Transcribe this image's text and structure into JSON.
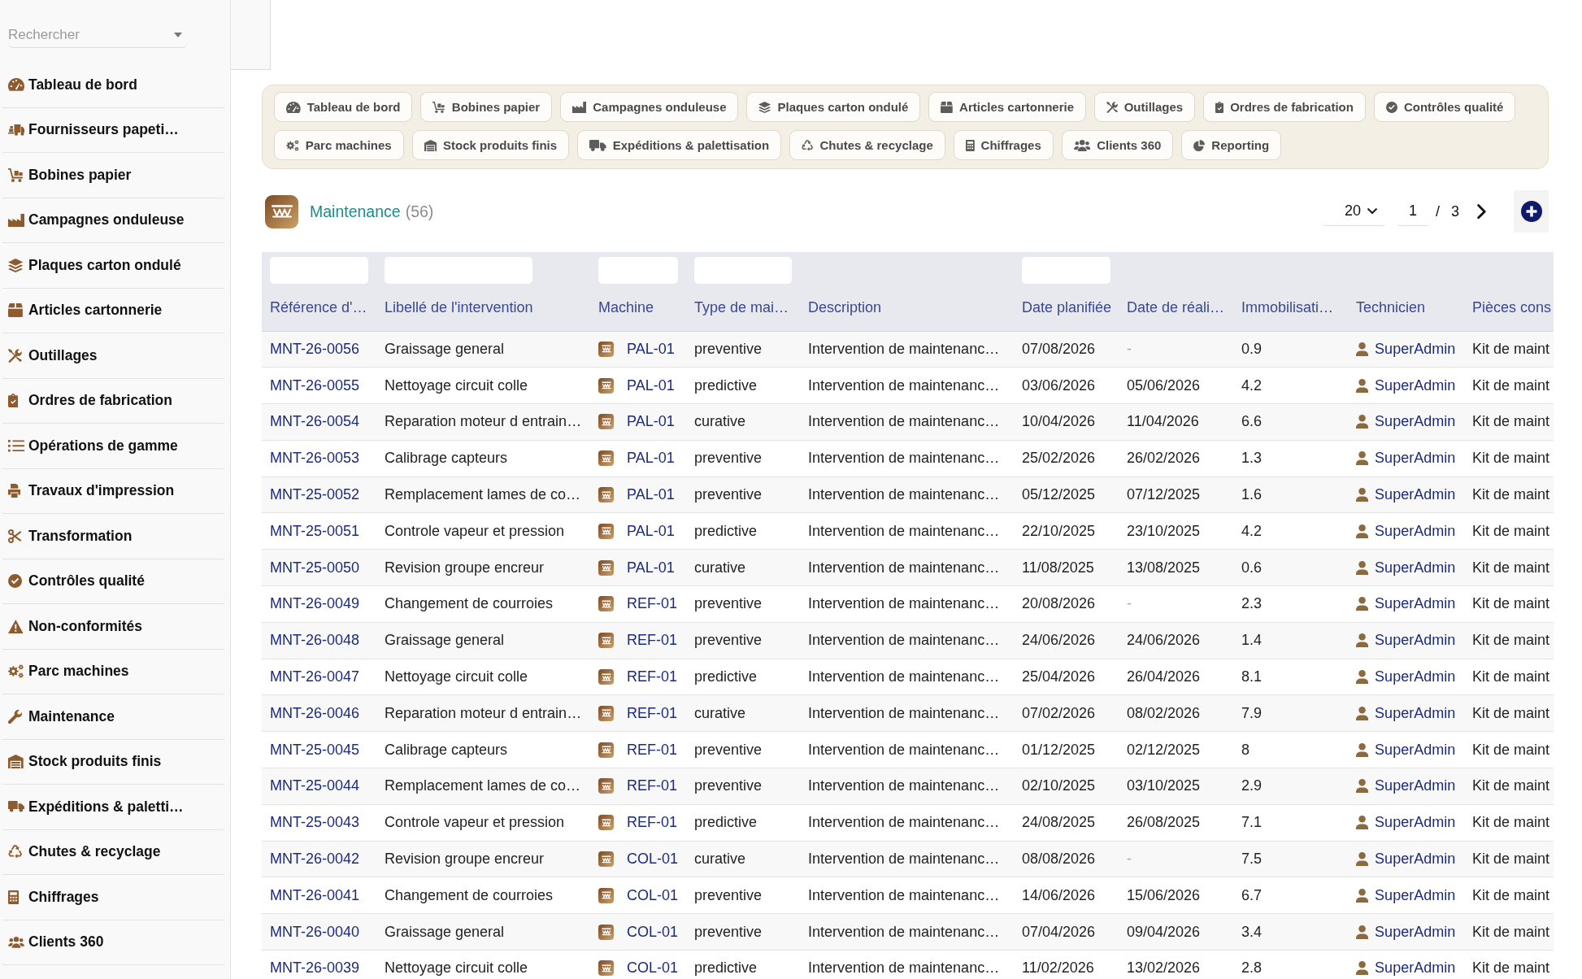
{
  "sidebar": {
    "search": {
      "placeholder": "Rechercher"
    },
    "items": [
      {
        "label": "Tableau de bord"
      },
      {
        "label": "Fournisseurs papeti…"
      },
      {
        "label": "Bobines papier"
      },
      {
        "label": "Campagnes onduleuse"
      },
      {
        "label": "Plaques carton ondulé"
      },
      {
        "label": "Articles cartonnerie"
      },
      {
        "label": "Outillages"
      },
      {
        "label": "Ordres de fabrication"
      },
      {
        "label": "Opérations de gamme"
      },
      {
        "label": "Travaux d'impression"
      },
      {
        "label": "Transformation"
      },
      {
        "label": "Contrôles qualité"
      },
      {
        "label": "Non-conformités"
      },
      {
        "label": "Parc machines"
      },
      {
        "label": "Maintenance"
      },
      {
        "label": "Stock produits finis"
      },
      {
        "label": "Expéditions & paletti…"
      },
      {
        "label": "Chutes & recyclage"
      },
      {
        "label": "Chiffrages"
      },
      {
        "label": "Clients 360"
      }
    ]
  },
  "tab_rows": [
    {
      "tabs": [
        {
          "label": "Tableau de bord"
        },
        {
          "label": "Bobines papier"
        },
        {
          "label": "Campagnes onduleuse"
        },
        {
          "label": "Plaques carton ondulé"
        },
        {
          "label": "Articles cartonnerie"
        },
        {
          "label": "Outillages"
        },
        {
          "label": "Ordres de fabrication"
        },
        {
          "label": "Contrôles qualité"
        }
      ]
    },
    {
      "tabs": [
        {
          "label": "Parc machines"
        },
        {
          "label": "Stock produits finis"
        },
        {
          "label": "Expéditions & palettisation"
        },
        {
          "label": "Chutes & recyclage"
        },
        {
          "label": "Chiffrages"
        },
        {
          "label": "Clients 360"
        },
        {
          "label": "Reporting"
        }
      ]
    }
  ],
  "header": {
    "title": "Maintenance",
    "count": "(56)"
  },
  "pagination": {
    "page_size": "20",
    "page": "1",
    "separator": "/",
    "total_pages": "3"
  },
  "table": {
    "columns": [
      {
        "label": "Référence d'…",
        "filter": true
      },
      {
        "label": "Libellé de l'intervention",
        "filter": true
      },
      {
        "label": "Machine",
        "filter": true
      },
      {
        "label": "Type de mai…",
        "filter": true
      },
      {
        "label": "Description",
        "filter": false
      },
      {
        "label": "Date planifiée",
        "filter": true
      },
      {
        "label": "Date de réali…",
        "filter": false
      },
      {
        "label": "Immobilisati…",
        "filter": false
      },
      {
        "label": "Technicien",
        "filter": false
      },
      {
        "label": "Pièces cons",
        "filter": false
      }
    ],
    "rows": [
      {
        "reference": "MNT-26-0056",
        "title": "Graissage general",
        "machine": "PAL-01",
        "type": "preventive",
        "description": "Intervention de maintenanc…",
        "planned": "07/08/2026",
        "completed": "-",
        "done": false,
        "downtime": "0.9",
        "technician": "SuperAdmin",
        "parts": "Kit de maint"
      },
      {
        "reference": "MNT-26-0055",
        "title": "Nettoyage circuit colle",
        "machine": "PAL-01",
        "type": "predictive",
        "description": "Intervention de maintenanc…",
        "planned": "03/06/2026",
        "completed": "05/06/2026",
        "done": true,
        "downtime": "4.2",
        "technician": "SuperAdmin",
        "parts": "Kit de maint"
      },
      {
        "reference": "MNT-26-0054",
        "title": "Reparation moteur d entrain…",
        "machine": "PAL-01",
        "type": "curative",
        "description": "Intervention de maintenanc…",
        "planned": "10/04/2026",
        "completed": "11/04/2026",
        "done": true,
        "downtime": "6.6",
        "technician": "SuperAdmin",
        "parts": "Kit de maint"
      },
      {
        "reference": "MNT-26-0053",
        "title": "Calibrage capteurs",
        "machine": "PAL-01",
        "type": "preventive",
        "description": "Intervention de maintenanc…",
        "planned": "25/02/2026",
        "completed": "26/02/2026",
        "done": true,
        "downtime": "1.3",
        "technician": "SuperAdmin",
        "parts": "Kit de maint"
      },
      {
        "reference": "MNT-25-0052",
        "title": "Remplacement lames de co…",
        "machine": "PAL-01",
        "type": "preventive",
        "description": "Intervention de maintenanc…",
        "planned": "05/12/2025",
        "completed": "07/12/2025",
        "done": true,
        "downtime": "1.6",
        "technician": "SuperAdmin",
        "parts": "Kit de maint"
      },
      {
        "reference": "MNT-25-0051",
        "title": "Controle vapeur et pression",
        "machine": "PAL-01",
        "type": "predictive",
        "description": "Intervention de maintenanc…",
        "planned": "22/10/2025",
        "completed": "23/10/2025",
        "done": true,
        "downtime": "4.2",
        "technician": "SuperAdmin",
        "parts": "Kit de maint"
      },
      {
        "reference": "MNT-25-0050",
        "title": "Revision groupe encreur",
        "machine": "PAL-01",
        "type": "curative",
        "description": "Intervention de maintenanc…",
        "planned": "11/08/2025",
        "completed": "13/08/2025",
        "done": true,
        "downtime": "0.6",
        "technician": "SuperAdmin",
        "parts": "Kit de maint"
      },
      {
        "reference": "MNT-26-0049",
        "title": "Changement de courroies",
        "machine": "REF-01",
        "type": "preventive",
        "description": "Intervention de maintenanc…",
        "planned": "20/08/2026",
        "completed": "-",
        "done": false,
        "downtime": "2.3",
        "technician": "SuperAdmin",
        "parts": "Kit de maint"
      },
      {
        "reference": "MNT-26-0048",
        "title": "Graissage general",
        "machine": "REF-01",
        "type": "preventive",
        "description": "Intervention de maintenanc…",
        "planned": "24/06/2026",
        "completed": "24/06/2026",
        "done": true,
        "downtime": "1.4",
        "technician": "SuperAdmin",
        "parts": "Kit de maint"
      },
      {
        "reference": "MNT-26-0047",
        "title": "Nettoyage circuit colle",
        "machine": "REF-01",
        "type": "predictive",
        "description": "Intervention de maintenanc…",
        "planned": "25/04/2026",
        "completed": "26/04/2026",
        "done": true,
        "downtime": "8.1",
        "technician": "SuperAdmin",
        "parts": "Kit de maint"
      },
      {
        "reference": "MNT-26-0046",
        "title": "Reparation moteur d entrain…",
        "machine": "REF-01",
        "type": "curative",
        "description": "Intervention de maintenanc…",
        "planned": "07/02/2026",
        "completed": "08/02/2026",
        "done": true,
        "downtime": "7.9",
        "technician": "SuperAdmin",
        "parts": "Kit de maint"
      },
      {
        "reference": "MNT-25-0045",
        "title": "Calibrage capteurs",
        "machine": "REF-01",
        "type": "preventive",
        "description": "Intervention de maintenanc…",
        "planned": "01/12/2025",
        "completed": "02/12/2025",
        "done": true,
        "downtime": "8",
        "technician": "SuperAdmin",
        "parts": "Kit de maint"
      },
      {
        "reference": "MNT-25-0044",
        "title": "Remplacement lames de co…",
        "machine": "REF-01",
        "type": "preventive",
        "description": "Intervention de maintenanc…",
        "planned": "02/10/2025",
        "completed": "03/10/2025",
        "done": true,
        "downtime": "2.9",
        "technician": "SuperAdmin",
        "parts": "Kit de maint"
      },
      {
        "reference": "MNT-25-0043",
        "title": "Controle vapeur et pression",
        "machine": "REF-01",
        "type": "predictive",
        "description": "Intervention de maintenanc…",
        "planned": "24/08/2025",
        "completed": "26/08/2025",
        "done": true,
        "downtime": "7.1",
        "technician": "SuperAdmin",
        "parts": "Kit de maint"
      },
      {
        "reference": "MNT-26-0042",
        "title": "Revision groupe encreur",
        "machine": "COL-01",
        "type": "curative",
        "description": "Intervention de maintenanc…",
        "planned": "08/08/2026",
        "completed": "-",
        "done": false,
        "downtime": "7.5",
        "technician": "SuperAdmin",
        "parts": "Kit de maint"
      },
      {
        "reference": "MNT-26-0041",
        "title": "Changement de courroies",
        "machine": "COL-01",
        "type": "preventive",
        "description": "Intervention de maintenanc…",
        "planned": "14/06/2026",
        "completed": "15/06/2026",
        "done": true,
        "downtime": "6.7",
        "technician": "SuperAdmin",
        "parts": "Kit de maint"
      },
      {
        "reference": "MNT-26-0040",
        "title": "Graissage general",
        "machine": "COL-01",
        "type": "preventive",
        "description": "Intervention de maintenanc…",
        "planned": "07/04/2026",
        "completed": "09/04/2026",
        "done": true,
        "downtime": "3.4",
        "technician": "SuperAdmin",
        "parts": "Kit de maint"
      },
      {
        "reference": "MNT-26-0039",
        "title": "Nettoyage circuit colle",
        "machine": "COL-01",
        "type": "predictive",
        "description": "Intervention de maintenanc…",
        "planned": "11/02/2026",
        "completed": "13/02/2026",
        "done": true,
        "downtime": "2.8",
        "technician": "SuperAdmin",
        "parts": "Kit de maint"
      }
    ]
  }
}
